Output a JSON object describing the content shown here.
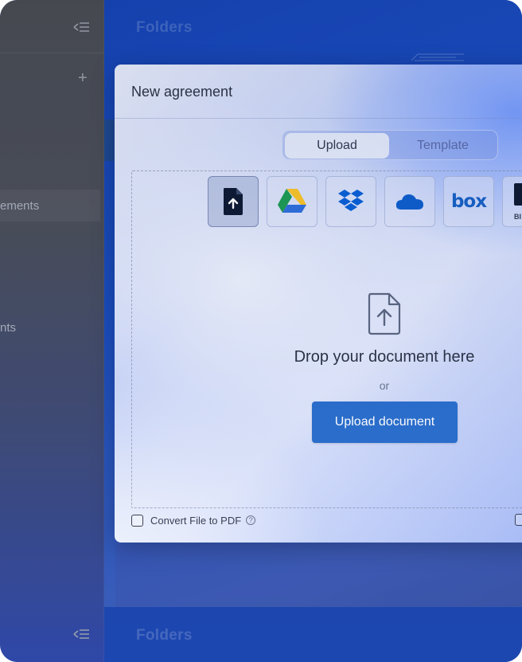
{
  "background": {
    "sidebar": {
      "active_item_fragment": "ements",
      "other_item_fragment": "nts"
    },
    "main": {
      "header_title": "Folders",
      "footer_title": "Folders"
    }
  },
  "modal": {
    "title": "New agreement",
    "tabs": [
      {
        "label": "Upload",
        "selected": true
      },
      {
        "label": "Template",
        "selected": false
      }
    ],
    "sources": [
      {
        "name": "device-upload",
        "icon": "file-upload-icon",
        "selected": true
      },
      {
        "name": "google-drive",
        "icon": "google-drive-icon"
      },
      {
        "name": "dropbox",
        "icon": "dropbox-icon"
      },
      {
        "name": "onedrive",
        "icon": "onedrive-icon"
      },
      {
        "name": "box",
        "icon": "box-icon",
        "label": "box"
      },
      {
        "name": "bim",
        "icon": "bim-icon",
        "label": "BI"
      }
    ],
    "dropzone": {
      "prompt": "Drop your document here",
      "or": "or",
      "button_label": "Upload document"
    },
    "convert_option": {
      "label": "Convert File to PDF",
      "checked": false,
      "help": "?"
    }
  },
  "colors": {
    "primary_button": "#2b6fcf",
    "box_brand": "#1761c7",
    "dropbox_brand": "#0a61d9",
    "onedrive_brand": "#0f5fd0"
  }
}
